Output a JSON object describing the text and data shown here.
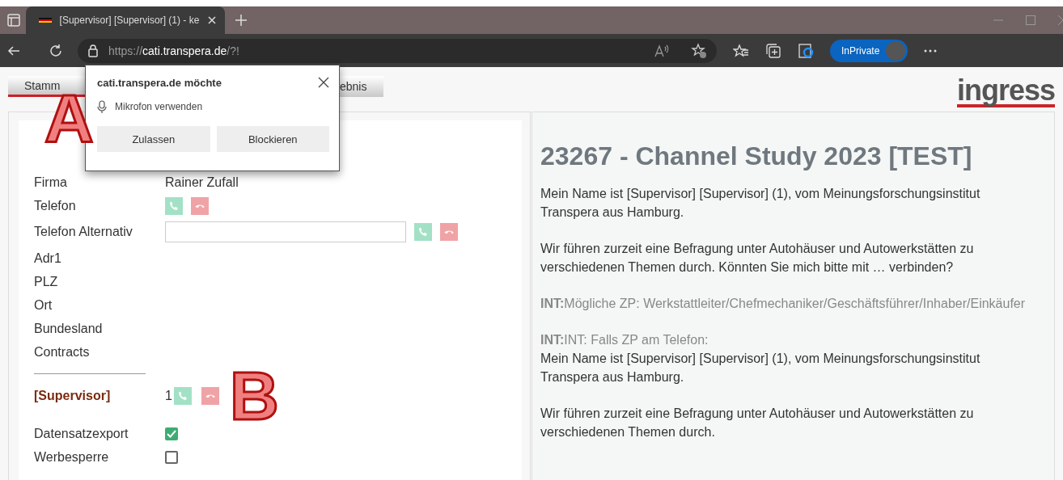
{
  "browser": {
    "tab_title": "[Supervisor] [Supervisor] (1) - ke",
    "url_scheme": "https://",
    "url_host": "cati.transpera.de",
    "url_path": "/?!",
    "inprivate": "InPrivate"
  },
  "permission_popup": {
    "title": "cati.transpera.de möchte",
    "request": "Mikrofon verwenden",
    "buttons": [
      "Zulassen",
      "Blockieren"
    ]
  },
  "tabs": [
    {
      "label": "Stamm",
      "selected": true
    },
    {
      "label": "ebnis",
      "selected": false
    }
  ],
  "logo": "ingress",
  "form": [
    {
      "kind": "text",
      "label": "Firma",
      "value": "Rainer Zufall"
    },
    {
      "kind": "phone",
      "label": "Telefon"
    },
    {
      "kind": "phone_input",
      "label": "Telefon Alternativ"
    },
    {
      "kind": "text",
      "label": "Adr1"
    },
    {
      "kind": "text",
      "label": "PLZ"
    },
    {
      "kind": "text",
      "label": "Ort"
    },
    {
      "kind": "text",
      "label": "Bundesland"
    },
    {
      "kind": "text",
      "label": "Contracts"
    },
    {
      "kind": "contact",
      "label": "[Supervisor]",
      "value": "1"
    },
    {
      "kind": "checkbox",
      "label": "Datensatzexport",
      "checked": true
    },
    {
      "kind": "checkbox",
      "label": "Werbesperre",
      "checked": false
    }
  ],
  "script": {
    "title": "23267 - Channel Study 2023 [TEST]",
    "blocks": [
      {
        "kind": "text",
        "text": "Mein Name ist [Supervisor] [Supervisor] (1), vom Meinungsforschungsinstitut Transpera aus Hamburg."
      },
      {
        "kind": "text",
        "text": "Wir führen zurzeit eine Befragung unter Autohäuser und Autowerkstätten zu verschiedenen Themen durch. Könnten Sie mich bitte mit … verbinden?"
      },
      {
        "kind": "instruction",
        "text": "**INT:**Mögliche ZP: Werkstattleiter/Chefmechaniker/Geschäftsführer/Inhaber/Einkäufer"
      },
      {
        "kind": "instruction",
        "text": "**INT:**INT: Falls ZP am Telefon:",
        "body": "Mein Name ist [Supervisor] [Supervisor] (1), vom Meinungsforschungsinstitut Transpera aus Hamburg."
      },
      {
        "kind": "text",
        "text": "Wir führen zurzeit eine Befragung unter Autohäuser und Autowerkstätten zu verschiedenen Themen durch."
      }
    ]
  },
  "annotations": [
    {
      "label": "A"
    },
    {
      "label": "B"
    }
  ]
}
